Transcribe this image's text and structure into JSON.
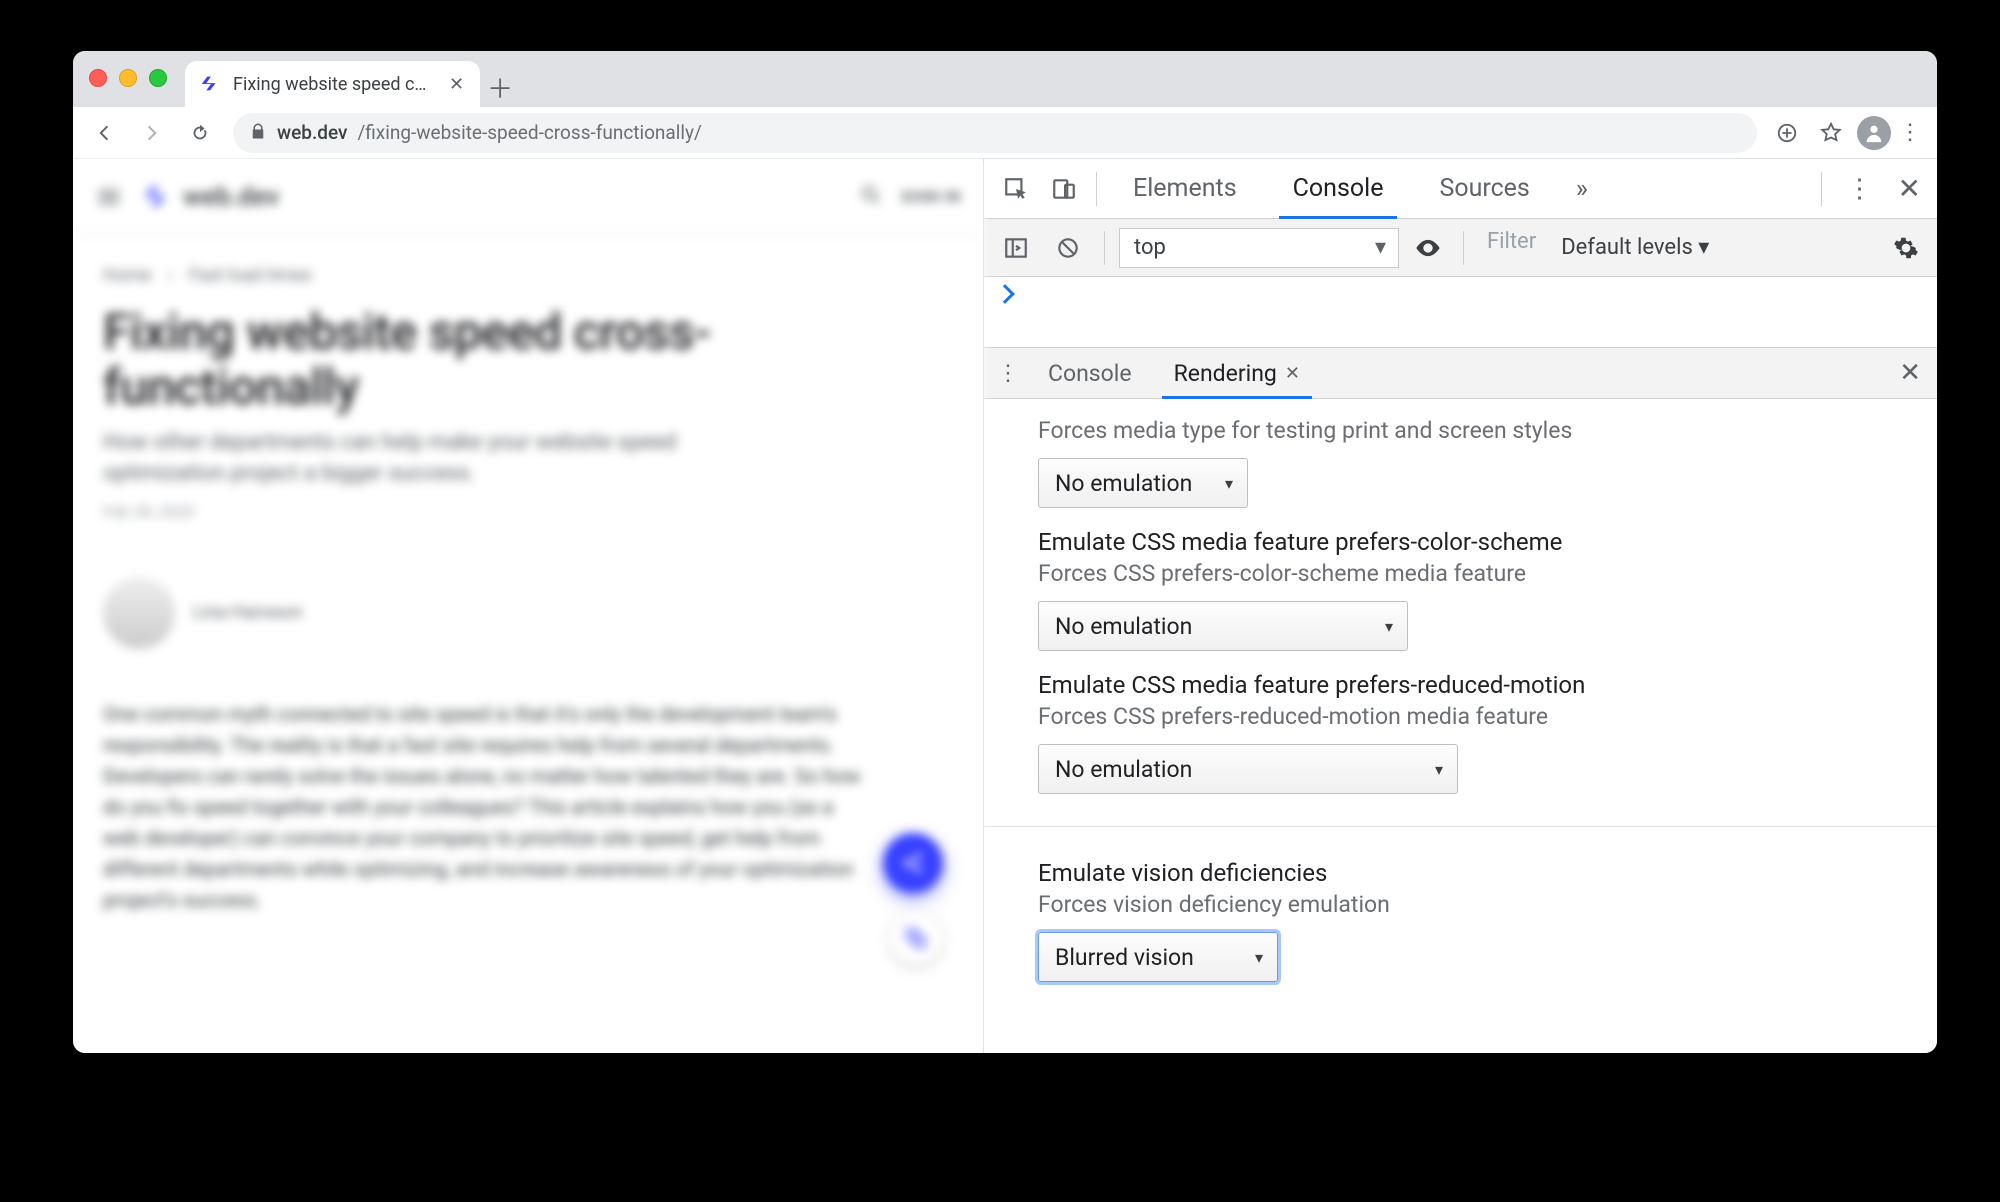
{
  "browser": {
    "tab_title": "Fixing website speed cross-functionally",
    "url_host": "web.dev",
    "url_path": "/fixing-website-speed-cross-functionally/"
  },
  "page": {
    "brand": "web.dev",
    "signin": "SIGN IN",
    "breadcrumb_home": "Home",
    "breadcrumb_section": "Fast load times",
    "title": "Fixing website speed cross-functionally",
    "subtitle": "How other departments can help make your website speed optimization project a bigger success.",
    "date": "Feb 28, 2020",
    "author": "Lina Hansson",
    "paragraph": "One common myth connected to site speed is that it's only the development team's responsibility. The reality is that a fast site requires help from several departments. Developers can rarely solve the issues alone, no matter how talented they are. So how do you fix speed together with your colleagues? This article explains how you (as a web developer) can convince your company to prioritize site speed, get help from different departments while optimizing, and increase awareness of your optimization project's success."
  },
  "devtools": {
    "tabs": {
      "elements": "Elements",
      "console": "Console",
      "sources": "Sources"
    },
    "toolbar": {
      "context": "top",
      "filter_placeholder": "Filter",
      "levels": "Default levels ▾"
    },
    "drawer": {
      "tabs": {
        "console": "Console",
        "rendering": "Rendering"
      },
      "media_type_desc": "Forces media type for testing print and screen styles",
      "media_type_value": "No emulation",
      "color_scheme_title": "Emulate CSS media feature prefers-color-scheme",
      "color_scheme_desc": "Forces CSS prefers-color-scheme media feature",
      "color_scheme_value": "No emulation",
      "reduced_motion_title": "Emulate CSS media feature prefers-reduced-motion",
      "reduced_motion_desc": "Forces CSS prefers-reduced-motion media feature",
      "reduced_motion_value": "No emulation",
      "vision_title": "Emulate vision deficiencies",
      "vision_desc": "Forces vision deficiency emulation",
      "vision_value": "Blurred vision"
    }
  }
}
